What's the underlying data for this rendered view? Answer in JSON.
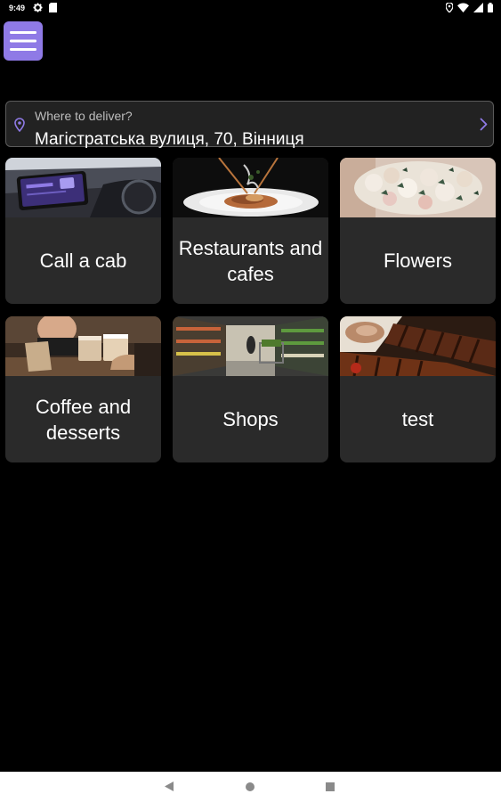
{
  "status_bar": {
    "time": "9:49",
    "icons": [
      "gear-icon",
      "sim-card-icon",
      "location-icon",
      "wifi-icon",
      "signal-icon",
      "battery-icon"
    ]
  },
  "menu": {
    "icon": "hamburger-menu-icon",
    "color": "#8f7ae6"
  },
  "address": {
    "label": "Where to deliver?",
    "value": "Магістратська вулиця, 70, Вінниця",
    "accent": "#8f7ae6"
  },
  "categories": [
    {
      "label": "Call a cab",
      "image": "car-dashboard-tablet-photo"
    },
    {
      "label": "Restaurants and cafes",
      "image": "pasta-dish-photo"
    },
    {
      "label": "Flowers",
      "image": "flower-bouquet-photo"
    },
    {
      "label": "Coffee and desserts",
      "image": "coffee-cups-photo"
    },
    {
      "label": "Shops",
      "image": "grocery-store-photo"
    },
    {
      "label": "test",
      "image": "grilled-ribs-photo"
    }
  ],
  "nav_bar": {
    "icons": [
      "back-icon",
      "home-icon",
      "recents-icon"
    ]
  }
}
